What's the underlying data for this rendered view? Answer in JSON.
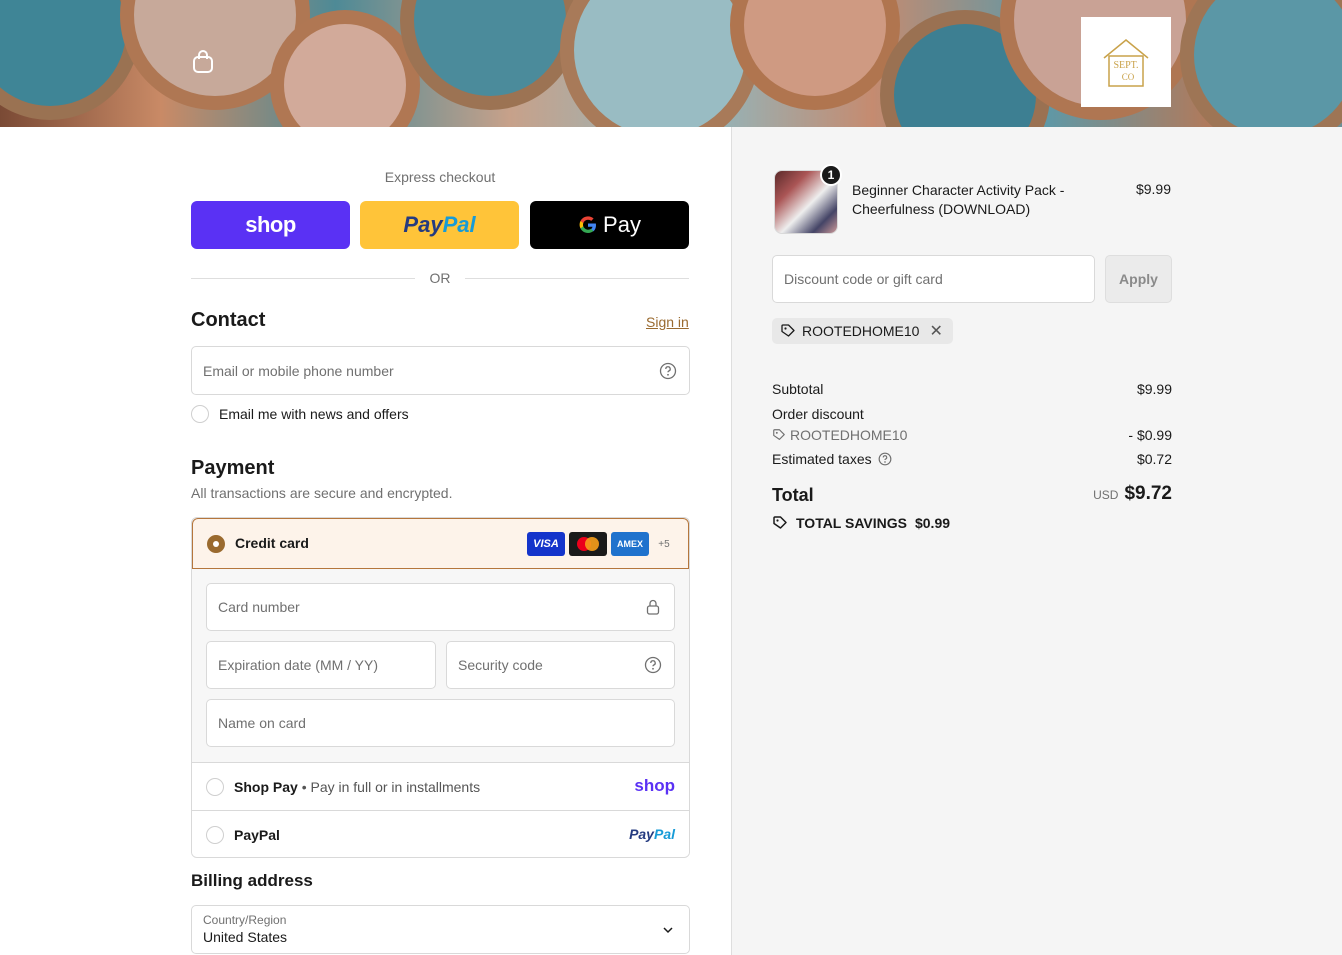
{
  "header": {
    "logo_text": "SEPT. CO",
    "logo_line1": "SEPT.",
    "logo_line2": "CO"
  },
  "express": {
    "label": "Express checkout",
    "shop_label": "shop",
    "paypal_label_a": "Pay",
    "paypal_label_b": "Pal",
    "gpay_label": "Pay",
    "or_text": "OR"
  },
  "contact": {
    "title": "Contact",
    "sign_in": "Sign in",
    "email_placeholder": "Email or mobile phone number",
    "news_label": "Email me with news and offers"
  },
  "payment": {
    "title": "Payment",
    "subtitle": "All transactions are secure and encrypted.",
    "credit_card_label": "Credit card",
    "card_brands": [
      "VISA",
      "Mastercard",
      "AMEX"
    ],
    "more_brands": "+5",
    "card_number_placeholder": "Card number",
    "expiration_placeholder": "Expiration date (MM / YY)",
    "security_placeholder": "Security code",
    "name_placeholder": "Name on card",
    "shop_pay_label": "Shop Pay",
    "shop_pay_sub": "• Pay in full or in installments",
    "shop_pay_logo": "shop",
    "paypal_label": "PayPal",
    "paypal_logo_a": "Pay",
    "paypal_logo_b": "Pal"
  },
  "billing": {
    "title": "Billing address",
    "country_label": "Country/Region",
    "country_value": "United States"
  },
  "order": {
    "item_name": "Beginner Character Activity Pack - Cheerfulness (DOWNLOAD)",
    "item_price": "$9.99",
    "item_qty": "1",
    "discount_placeholder": "Discount code or gift card",
    "apply_label": "Apply",
    "applied_code": "ROOTEDHOME10",
    "subtotal_label": "Subtotal",
    "subtotal_value": "$9.99",
    "order_discount_label": "Order discount",
    "discount_code": "ROOTEDHOME10",
    "discount_value": "- $0.99",
    "taxes_label": "Estimated taxes",
    "taxes_value": "$0.72",
    "total_label": "Total",
    "currency": "USD",
    "total_value": "$9.72",
    "savings_label": "TOTAL SAVINGS",
    "savings_value": "$0.99"
  },
  "colors": {
    "accent": "#9a6a2f",
    "shop_purple": "#5a31f4",
    "paypal_yellow": "#ffc439"
  }
}
